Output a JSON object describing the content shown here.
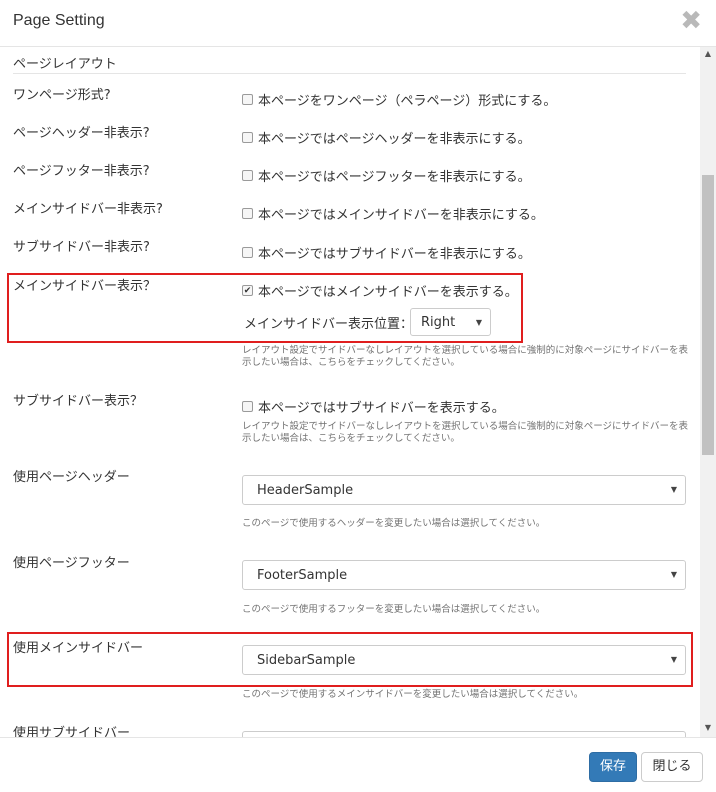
{
  "header": {
    "title": "Page Setting",
    "close_glyph": "✖"
  },
  "section": {
    "title": "ページレイアウト"
  },
  "rows": [
    {
      "label": "ワンページ形式?",
      "checkbox": "本ページをワンページ（ペラページ）形式にする。",
      "checked": false
    },
    {
      "label": "ページヘッダー非表示?",
      "checkbox": "本ページではページヘッダーを非表示にする。",
      "checked": false
    },
    {
      "label": "ページフッター非表示?",
      "checkbox": "本ページではページフッターを非表示にする。",
      "checked": false
    },
    {
      "label": "メインサイドバー非表示?",
      "checkbox": "本ページではメインサイドバーを非表示にする。",
      "checked": false
    },
    {
      "label": "サブサイドバー非表示?",
      "checkbox": "本ページではサブサイドバーを非表示にする。",
      "checked": false
    }
  ],
  "main_sidebar_show": {
    "label": "メインサイドバー表示？",
    "checkbox": "本ページではメインサイドバーを表示する。",
    "checked": true,
    "position_label": "メインサイドバー表示位置：",
    "position_value": "Right",
    "help": "レイアウト設定でサイドバーなしレイアウトを選択している場合に強制的に対象ページにサイドバーを表示したい場合は、こちらをチェックしてください。"
  },
  "sub_sidebar_show": {
    "label": "サブサイドバー表示？",
    "checkbox": "本ページではサブサイドバーを表示する。",
    "checked": false,
    "help": "レイアウト設定でサイドバーなしレイアウトを選択している場合に強制的に対象ページにサイドバーを表示したい場合は、こちらをチェックしてください。"
  },
  "page_header": {
    "label": "使用ページヘッダー",
    "value": "HeaderSample",
    "help": "このページで使用するヘッダーを変更したい場合は選択してください。"
  },
  "page_footer": {
    "label": "使用ページフッター",
    "value": "FooterSample",
    "help": "このページで使用するフッターを変更したい場合は選択してください。"
  },
  "main_sidebar": {
    "label": "使用メインサイドバー",
    "value": "SidebarSample",
    "help": "このページで使用するメインサイドバーを変更したい場合は選択してください。"
  },
  "sub_sidebar": {
    "label": "使用サブサイドバー"
  },
  "footer": {
    "save_label": "保存",
    "close_label": "閉じる"
  },
  "colors": {
    "primary": "#337ab7",
    "highlight": "#e01e1e"
  }
}
